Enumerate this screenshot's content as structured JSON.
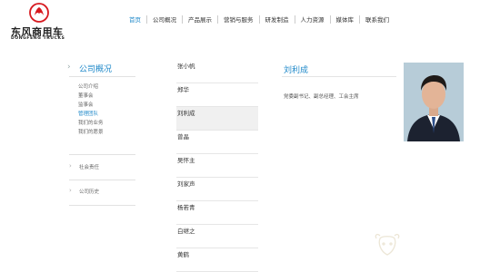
{
  "brand": {
    "name_cn": "东风商用车",
    "name_en": "DONGFENG TRUCKS",
    "logo_color": "#d7191f"
  },
  "nav": {
    "items": [
      {
        "label": "首页",
        "active": true
      },
      {
        "label": "公司概况"
      },
      {
        "label": "产品展示"
      },
      {
        "label": "营销与服务"
      },
      {
        "label": "研发制造"
      },
      {
        "label": "人力资源"
      },
      {
        "label": "媒体库"
      },
      {
        "label": "联系我们"
      }
    ],
    "accent_color": "#1e88c9"
  },
  "sidebar": {
    "title": "公司概况",
    "sub_items": [
      {
        "label": "公司介绍"
      },
      {
        "label": "董事会"
      },
      {
        "label": "监事会"
      },
      {
        "label": "管理团队",
        "active": true
      },
      {
        "label": "我们的业务"
      },
      {
        "label": "我们的愿景"
      }
    ],
    "sections": [
      {
        "label": "社会责任"
      },
      {
        "label": "公司历史"
      }
    ]
  },
  "people": [
    {
      "name": "张小帆"
    },
    {
      "name": "郑华"
    },
    {
      "name": "刘利成",
      "active": true
    },
    {
      "name": "曾晶"
    },
    {
      "name": "吴怀主"
    },
    {
      "name": "刘家声"
    },
    {
      "name": "杨若青"
    },
    {
      "name": "白继之"
    },
    {
      "name": "黄鹤"
    }
  ],
  "detail": {
    "name": "刘利成",
    "title": "党委副书记、副总经理、工会主席"
  }
}
